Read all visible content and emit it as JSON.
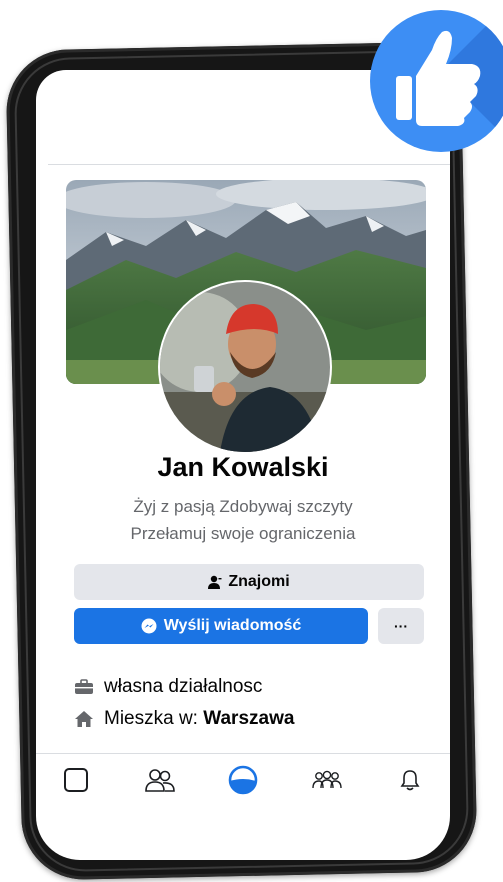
{
  "profile": {
    "name": "Jan Kowalski",
    "bio_line_1": "Żyj z pasją Zdobywaj szczyty",
    "bio_line_2": "Przełamuj swoje ograniczenia"
  },
  "actions": {
    "friends_label": "Znajomi",
    "message_label": "Wyślij wiadomość",
    "more_label": "···"
  },
  "info": {
    "work": "własna działalnosc",
    "lives_prefix": "Mieszka w:",
    "lives_city": "Warszawa"
  },
  "bottom_nav": {
    "items": [
      "home-square-icon",
      "friends-icon",
      "profile-circle-icon",
      "groups-icon",
      "bell-icon"
    ],
    "active": "profile-circle-icon"
  },
  "icons": {
    "friends_button": "person-icon",
    "message_button": "messenger-icon",
    "work": "briefcase-icon",
    "lives": "house-icon",
    "badge": "thumbs-up-icon"
  },
  "colors": {
    "accent": "#1b74e4",
    "badge": "#3d8ef4",
    "secondary_button": "#e4e6eb"
  }
}
